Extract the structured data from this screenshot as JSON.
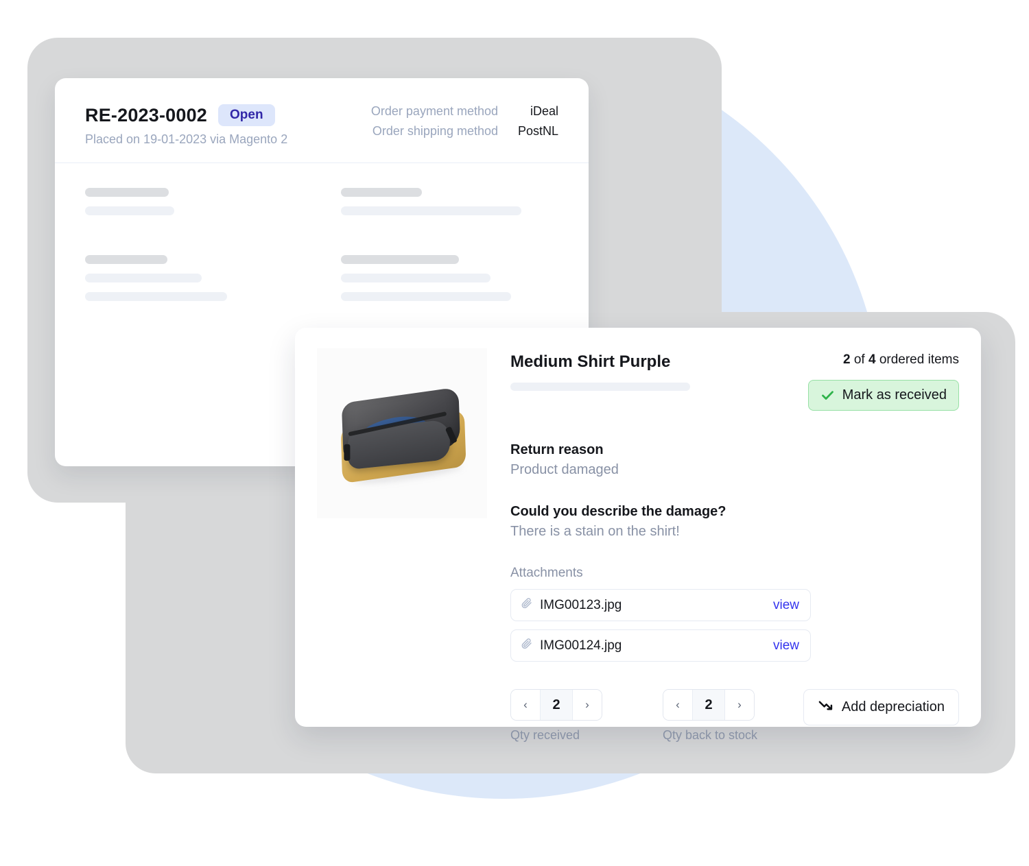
{
  "return_card": {
    "id": "RE-2023-0002",
    "status_badge": "Open",
    "placed_on": "Placed on 19-01-2023 via Magento 2",
    "meta": [
      {
        "label": "Order payment method",
        "value": "iDeal"
      },
      {
        "label": "Order shipping method",
        "value": "PostNL"
      }
    ]
  },
  "item_card": {
    "product_title": "Medium Shirt Purple",
    "ordered_count_prefix": "",
    "ordered_qty": "2",
    "ordered_of": " of ",
    "ordered_total": "4",
    "ordered_suffix": " ordered items",
    "mark_received_label": "Mark as received",
    "return_reason_label": "Return reason",
    "return_reason_value": "Product damaged",
    "damage_question_label": "Could you describe the damage?",
    "damage_question_value": "There is a stain on the shirt!",
    "attachments_label": "Attachments",
    "attachments": [
      {
        "name": "IMG00123.jpg",
        "action": "view"
      },
      {
        "name": "IMG00124.jpg",
        "action": "view"
      }
    ],
    "qty_received": {
      "value": "2",
      "label": "Qty received",
      "prev": "‹",
      "next": "›"
    },
    "qty_back_to_stock": {
      "value": "2",
      "label": "Qty back to stock",
      "prev": "‹",
      "next": "›"
    },
    "add_depreciation_label": "Add depreciation"
  },
  "colors": {
    "badge_bg": "#dde6fb",
    "badge_text": "#3127a8",
    "accent_link": "#3333ee",
    "success_bg": "#d8f5dc",
    "success_border": "#97e0a5",
    "success_icon": "#2eb34a",
    "backdrop_blue": "#dce8f9",
    "backdrop_gray": "#d7d8d9",
    "muted_text": "#8891a5"
  }
}
